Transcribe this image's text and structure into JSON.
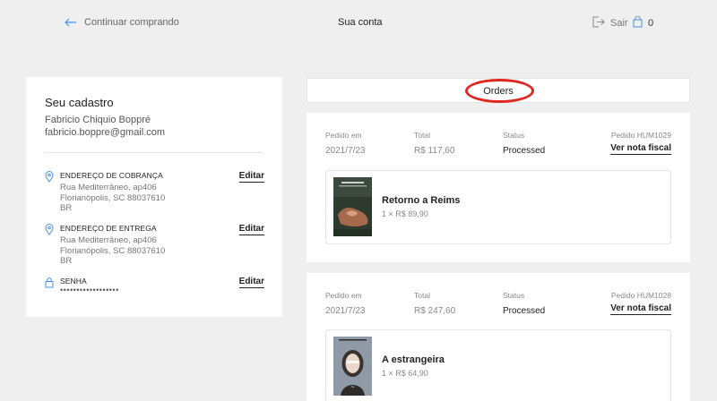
{
  "topbar": {
    "back_label": "Continuar comprando",
    "title": "Sua conta",
    "logout_label": "Sair",
    "cart_count": "0"
  },
  "account": {
    "heading": "Seu cadastro",
    "name": "Fabricio Chiquio Boppré",
    "email": "fabricio.boppre@gmail.com",
    "billing": {
      "label": "ENDEREÇO DE COBRANÇA",
      "lines": [
        "Rua Mediterrâneo, ap406",
        "Florianópolis, SC 88037610",
        "BR"
      ],
      "edit_label": "Editar"
    },
    "shipping": {
      "label": "ENDEREÇO DE ENTREGA",
      "lines": [
        "Rua Mediterrâneo, ap406",
        "Florianópolis, SC 88037610",
        "BR"
      ],
      "edit_label": "Editar"
    },
    "password": {
      "label": "SENHA",
      "masked": "••••••••••••••••••",
      "edit_label": "Editar"
    }
  },
  "orders": {
    "title": "Orders",
    "columns": {
      "date": "Pedido em",
      "total": "Total",
      "status": "Status"
    },
    "invoice_label": "Ver nota fiscal",
    "list": [
      {
        "date": "2021/7/23",
        "total": "R$ 117,60",
        "status": "Processed",
        "order_id": "Pedido HUM1029",
        "item_title": "Retorno a Reims",
        "item_qty": "1 × R$ 89,90"
      },
      {
        "date": "2021/7/23",
        "total": "R$ 247,60",
        "status": "Processed",
        "order_id": "Pedido HUM1028",
        "item_title": "A estrangeira",
        "item_qty": "1 × R$ 64,90"
      }
    ]
  },
  "colors": {
    "accent": "#4a90e2",
    "highlight_circle": "#e0261e",
    "background": "#efefef"
  }
}
